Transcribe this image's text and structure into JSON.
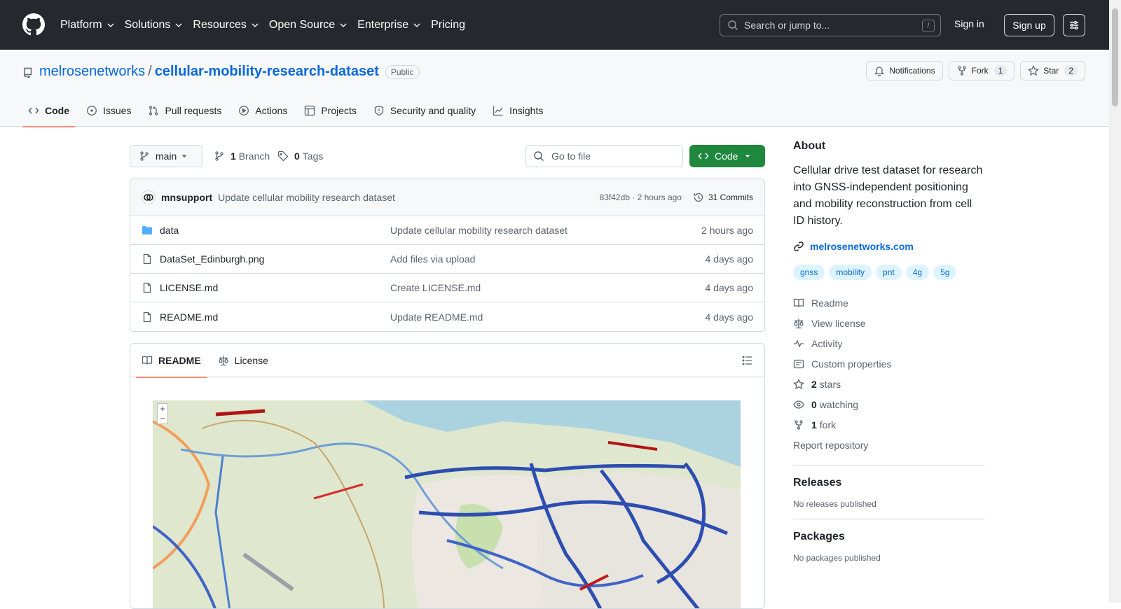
{
  "header": {
    "nav": [
      "Platform",
      "Solutions",
      "Resources",
      "Open Source",
      "Enterprise"
    ],
    "pricing": "Pricing",
    "search_placeholder": "Search or jump to...",
    "search_key": "/",
    "sign_in": "Sign in",
    "sign_up": "Sign up"
  },
  "repo": {
    "owner": "melrosenetworks",
    "separator": "/",
    "name": "cellular-mobility-research-dataset",
    "visibility": "Public",
    "notifications_label": "Notifications",
    "fork_label": "Fork",
    "fork_count": "1",
    "star_label": "Star",
    "star_count": "2",
    "tabs": [
      "Code",
      "Issues",
      "Pull requests",
      "Actions",
      "Projects",
      "Security and quality",
      "Insights"
    ]
  },
  "toolbar": {
    "branch": "main",
    "branch_count": "1",
    "branch_label": "Branch",
    "tag_count": "0",
    "tag_label": "Tags",
    "go_to_file": "Go to file",
    "code_button": "Code"
  },
  "latest_commit": {
    "author": "mnsupport",
    "message": "Update cellular mobility research dataset",
    "hash_time": "83f42db · 2 hours ago",
    "commits": "31 Commits"
  },
  "files": [
    {
      "name": "data",
      "type": "folder",
      "message": "Update cellular mobility research dataset",
      "date": "2 hours ago"
    },
    {
      "name": "DataSet_Edinburgh.png",
      "type": "file",
      "message": "Add files via upload",
      "date": "4 days ago"
    },
    {
      "name": "LICENSE.md",
      "type": "file",
      "message": "Create LICENSE.md",
      "date": "4 days ago"
    },
    {
      "name": "README.md",
      "type": "file",
      "message": "Update README.md",
      "date": "4 days ago"
    }
  ],
  "readme": {
    "tab_readme": "README",
    "tab_license": "License",
    "map_zoom_in": "+",
    "map_zoom_out": "−"
  },
  "about": {
    "heading": "About",
    "description": "Cellular drive test dataset for research into GNSS-independent positioning and mobility reconstruction from cell ID history.",
    "website": "melrosenetworks.com",
    "topics": [
      "gnss",
      "mobility",
      "pnt",
      "4g",
      "5g"
    ],
    "readme": "Readme",
    "license": "View license",
    "activity": "Activity",
    "custom_properties": "Custom properties",
    "stars_count": "2",
    "stars_label": "stars",
    "watching_count": "0",
    "watching_label": "watching",
    "fork_count": "1",
    "fork_label": "fork",
    "report": "Report repository"
  },
  "releases": {
    "heading": "Releases",
    "note": "No releases published"
  },
  "packages": {
    "heading": "Packages",
    "note": "No packages published"
  },
  "colors": {
    "accent": "#0969da",
    "header_bg": "#25292e",
    "code_green": "#1f883d",
    "tab_underline": "#fd8c73"
  }
}
